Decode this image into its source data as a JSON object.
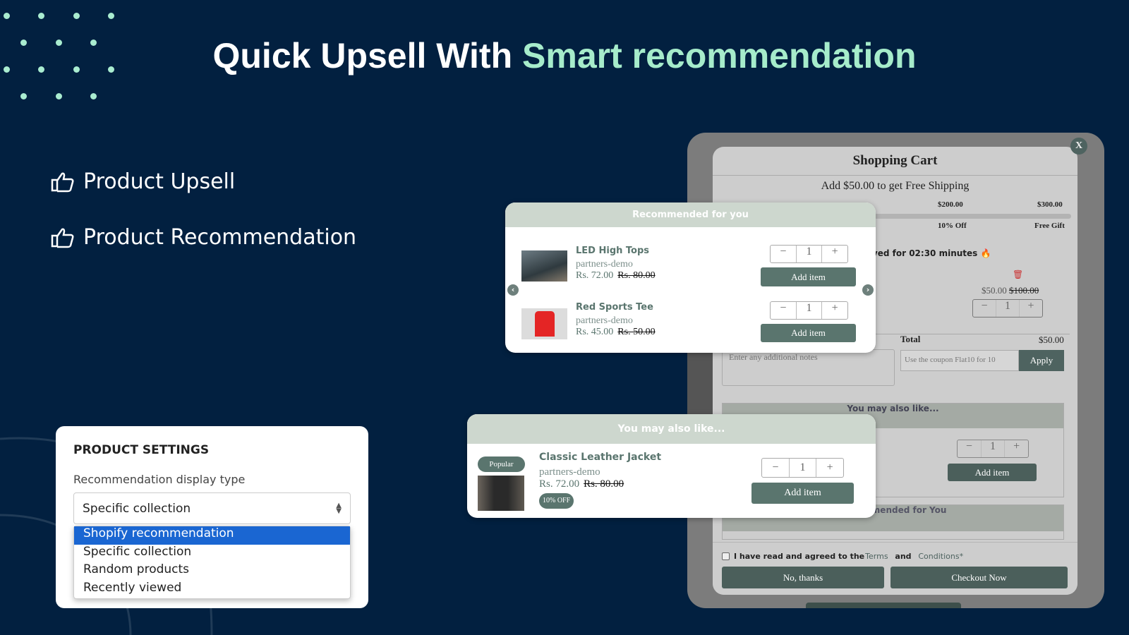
{
  "headline": {
    "part1": "Quick Upsell With ",
    "part2": "Smart recommendation"
  },
  "features": [
    {
      "icon": "thumbs-up-icon",
      "label": "Product Upsell"
    },
    {
      "icon": "thumbs-up-icon",
      "label": "Product Recommendation"
    }
  ],
  "settings": {
    "title": "PRODUCT SETTINGS",
    "field_label": "Recommendation display type",
    "selected": "Specific collection",
    "options": [
      "Shopify recommendation",
      "Specific collection",
      "Random products",
      "Recently viewed"
    ],
    "highlighted": "Shopify recommendation"
  },
  "cart": {
    "title": "Shopping Cart",
    "close": "X",
    "shipping": "Add $50.00 to get Free Shipping",
    "milestones": [
      {
        "amount": "$200.00",
        "reward": "10% Off"
      },
      {
        "amount": "$300.00",
        "reward": "Free Gift"
      }
    ],
    "reserved": "rved for 02:30 minutes",
    "item_price": "$50.00",
    "item_compare": "$100.00",
    "item_qty": "1",
    "notes_placeholder": "Enter any additional notes",
    "total_label": "Total",
    "total_value": "$50.00",
    "coupon_placeholder": "Use the coupon Flat10 for 10",
    "apply": "Apply",
    "also_like": "You may also like...",
    "also_qty": "1",
    "add_item": "Add item",
    "recommended": "Recommended for You",
    "terms_pre": "I have read and agreed to the ",
    "terms": "Terms",
    "and": " and ",
    "conditions": "Conditions*",
    "no_thanks": "No, thanks",
    "checkout": "Checkout Now"
  },
  "recommended_popup": {
    "title": "Recommended for you",
    "items": [
      {
        "name": "LED High Tops",
        "vendor": "partners-demo",
        "price": "Rs. 72.00",
        "compare": "Rs. 80.00",
        "qty": "1",
        "button": "Add item"
      },
      {
        "name": "Red Sports Tee",
        "vendor": "partners-demo",
        "price": "Rs. 45.00",
        "compare": "Rs. 50.00",
        "qty": "1",
        "button": "Add item"
      }
    ]
  },
  "also_popup": {
    "title": "You may also like...",
    "item": {
      "badge": "Popular",
      "name": "Classic Leather Jacket",
      "vendor": "partners-demo",
      "price": "Rs. 72.00",
      "compare": "Rs. 80.00",
      "discount": "10% OFF",
      "qty": "1",
      "button": "Add item"
    }
  },
  "colors": {
    "background": "#022040",
    "accent": "#a6eccb",
    "button": "#5a756e",
    "highlight": "#1a66d2"
  }
}
